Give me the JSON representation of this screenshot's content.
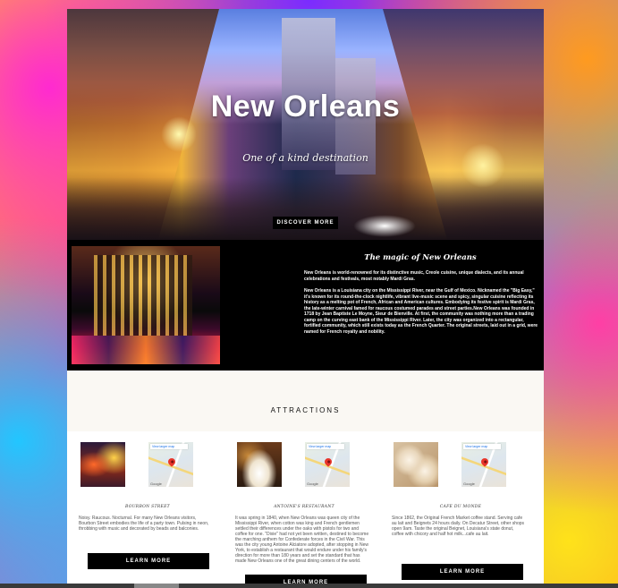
{
  "hero": {
    "title": "New Orleans",
    "subtitle": "One of a kind destination",
    "button": "DISCOVER MORE"
  },
  "magic": {
    "title": "The magic of New Orleans",
    "p1": "New Orleans is world-renowned for its distinctive music, Creole cuisine, unique dialects, and its annual celebrations and festivals, most notably Mardi Gras.",
    "p2": "New Orleans is a Louisiana city on the Mississippi River, near the Gulf of Mexico. Nicknamed the \"Big Easy,\" it's known for its round-the-clock nightlife, vibrant live-music scene and spicy, singular cuisine reflecting its history as a melting pot of French, African and American cultures. Embodying its festive spirit is Mardi Gras, the late-winter carnival famed for raucous costumed parades and street parties.New Orleans was founded in 1718 by Jean Baptiste Le Moyne, Sieur de Bienville. At first, the community was nothing more than a trading camp on the curving east bank of the Mississippi River. Later, the city was organized into a rectangular, fortified community, which still exists today as the French Quarter. The original streets, laid out in a grid, were named for French royalty and nobility."
  },
  "attractions": {
    "title": "ATTRACTIONS",
    "map_link": "View larger map",
    "map_brand": "Google",
    "items": [
      {
        "name": "BOURBON STREET",
        "text": "Noisy. Raucous. Nocturnal. For many New Orleans visitors, Bourbon Street embodies the life of a party town. Pulsing in neon, throbbing with music and decorated by beads and balconies.",
        "button": "LEARN MORE"
      },
      {
        "name": "ANTOINE'S RESTAURANT",
        "text": "It was spring in 1840, when New Orleans was queen city of the Mississippi River, when cotton was king and French gentlemen settled their differences under the oaks with pistols for two and coffee for one. \"Dixie\" had not yet been written, destined to become the marching anthem for Confederate forces in the Civil War. This was the city young Antoine Alciatore adopted, after stopping in New York, to establish a restaurant that would endure under his family's direction for more than 180 years and set the standard that has made New Orleans one of the great dining centers of the world.",
        "button": "LEARN MORE"
      },
      {
        "name": "CAFE DU MONDE",
        "text": "Since 1862, the Original French Market coffee stand. Serving cafe au lait and Beignets 24 hours daily. On Decatur Street, other shops open 9am. Taste the original Beignet, Louisiana's state donut, coffee with chicory and half hot milk...cafe au lait.",
        "button": "LEARN MORE"
      }
    ]
  }
}
